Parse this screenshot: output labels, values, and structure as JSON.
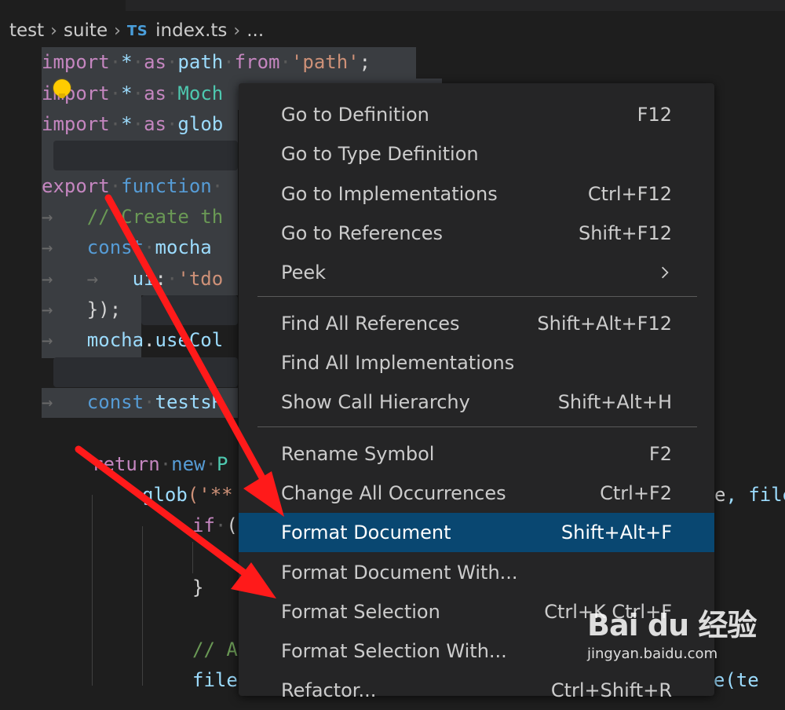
{
  "breadcrumb": {
    "items": [
      "test",
      "suite",
      "index.ts",
      "..."
    ],
    "ts_badge": "TS"
  },
  "code": {
    "l1": {
      "kw": "import",
      "star": "*",
      "as": "as",
      "name": "path",
      "from": "from",
      "str": "'path'",
      "end": ";"
    },
    "l2": {
      "kw": "import",
      "star": "*",
      "as": "as",
      "name": "Moch"
    },
    "l3": {
      "kw": "import",
      "star": "*",
      "as": "as",
      "name": "glob"
    },
    "l5": {
      "kw": "export",
      "fn": "function"
    },
    "l6": {
      "comment": "// Create th"
    },
    "l7": {
      "kw": "const",
      "name": "mocha"
    },
    "l8": {
      "prop": "ui",
      "str": "'tdo"
    },
    "l9": {
      "text": "});"
    },
    "l10": {
      "obj": "mocha",
      "method": "useCol"
    },
    "l12": {
      "kw": "const",
      "name": "testsR"
    },
    "l14": {
      "kw": "return",
      "kw2": "new",
      "name": "P"
    },
    "l15": {
      "fn": "glob",
      "str": "('**",
      "tail": ", file"
    },
    "l16": {
      "kw": "if",
      "rest": "("
    },
    "l18": {
      "text": "}"
    },
    "l20": {
      "comment": "// A"
    },
    "l21": {
      "name": "file",
      "tail": "lve(te"
    }
  },
  "menu": {
    "items": [
      {
        "label": "Go to Definition",
        "key": "F12"
      },
      {
        "label": "Go to Type Definition",
        "key": ""
      },
      {
        "label": "Go to Implementations",
        "key": "Ctrl+F12"
      },
      {
        "label": "Go to References",
        "key": "Shift+F12"
      },
      {
        "label": "Peek",
        "key": ""
      },
      {
        "label": "Find All References",
        "key": "Shift+Alt+F12"
      },
      {
        "label": "Find All Implementations",
        "key": ""
      },
      {
        "label": "Show Call Hierarchy",
        "key": "Shift+Alt+H"
      },
      {
        "label": "Rename Symbol",
        "key": "F2"
      },
      {
        "label": "Change All Occurrences",
        "key": "Ctrl+F2"
      },
      {
        "label": "Format Document",
        "key": "Shift+Alt+F"
      },
      {
        "label": "Format Document With...",
        "key": ""
      },
      {
        "label": "Format Selection",
        "key": "Ctrl+K Ctrl+F"
      },
      {
        "label": "Format Selection With...",
        "key": ""
      },
      {
        "label": "Refactor...",
        "key": "Ctrl+Shift+R"
      }
    ],
    "active_index": 10
  },
  "watermark": {
    "logo": "Bai du 经验",
    "url": "jingyan.baidu.com"
  },
  "colors": {
    "editor_bg": "#1e1e1e",
    "menu_bg": "#252526",
    "menu_active": "#094771",
    "arrow": "#ff1a1a"
  }
}
